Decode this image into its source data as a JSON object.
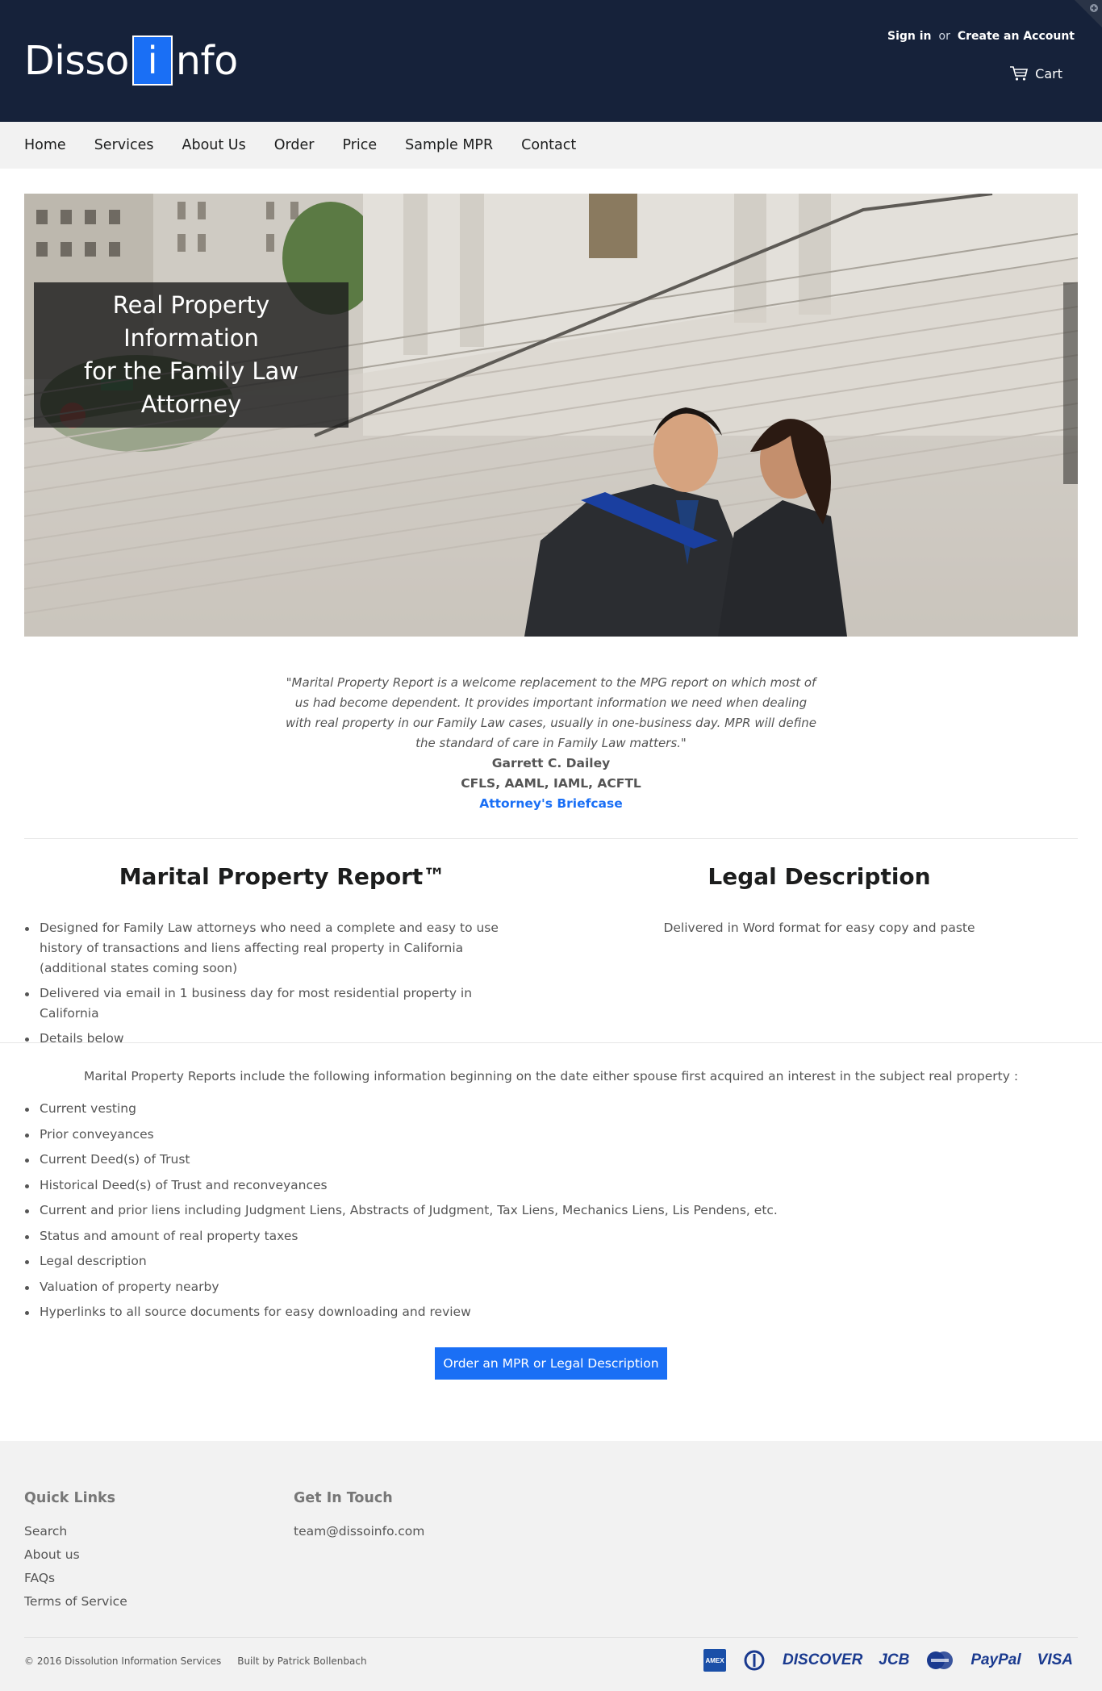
{
  "header": {
    "logo_left": "Disso",
    "logo_box": "i",
    "logo_right": "nfo",
    "sign_in": "Sign in",
    "or": "or",
    "create_account": "Create an Account",
    "cart": "Cart"
  },
  "nav": {
    "items": [
      {
        "label": "Home"
      },
      {
        "label": "Services"
      },
      {
        "label": "About Us"
      },
      {
        "label": "Order"
      },
      {
        "label": "Price"
      },
      {
        "label": "Sample MPR"
      },
      {
        "label": "Contact"
      }
    ]
  },
  "hero": {
    "caption_line1": "Real Property Information",
    "caption_line2": "for the Family Law Attorney"
  },
  "testimonial": {
    "quote": "\"Marital Property Report is a welcome replacement to the MPG report on which most of us had become dependent. It provides important information we need when dealing with real property in our Family Law cases, usually in one-business day. MPR will define the standard of care in Family Law matters.\"",
    "author": "Garrett C. Dailey",
    "credentials": "CFLS, AAML, IAML, ACFTL",
    "source": "Attorney's Briefcase"
  },
  "mpr": {
    "title": "Marital Property Report™",
    "bullets": [
      "Designed for Family Law attorneys who need a complete and easy to use history of transactions and liens affecting real property in California (additional states coming soon)",
      "Delivered via email in 1 business day for most residential property in California",
      "Details below"
    ]
  },
  "legal": {
    "title": "Legal Description",
    "text": "Delivered in Word format for easy copy and paste"
  },
  "includes": {
    "intro": "Marital Property Reports include the following information beginning on the date either spouse first acquired an interest in the subject real property :",
    "items": [
      "Current vesting",
      "Prior conveyances",
      "Current Deed(s) of Trust",
      "Historical Deed(s) of Trust and reconveyances",
      "Current and prior liens including Judgment Liens, Abstracts of Judgment, Tax Liens, Mechanics Liens, Lis Pendens, etc.",
      "Status and amount of real property taxes",
      "Legal description",
      "Valuation of property nearby",
      "Hyperlinks to all source documents for easy downloading and review"
    ],
    "order_button": "Order an MPR or Legal Description"
  },
  "footer": {
    "quick_links_title": "Quick Links",
    "quick_links": [
      "Search",
      "About us",
      "FAQs",
      "Terms of Service"
    ],
    "contact_title": "Get In Touch",
    "email": "team@dissoinfo.com",
    "copyright": "© 2016 Dissolution Information Services",
    "built_by": "Built by Patrick Bollenbach",
    "payment_icons": [
      "amex-icon",
      "diners-icon",
      "discover-icon",
      "jcb-icon",
      "mastercard-icon",
      "paypal-icon",
      "visa-icon"
    ],
    "payment_labels": {
      "discover": "DISCOVER",
      "jcb": "JCB",
      "paypal": "PayPal",
      "visa": "VISA"
    }
  },
  "colors": {
    "header_bg": "#16223a",
    "accent": "#1a6ff5",
    "nav_bg": "#f2f2f2",
    "footer_bg": "#f2f2f2"
  }
}
